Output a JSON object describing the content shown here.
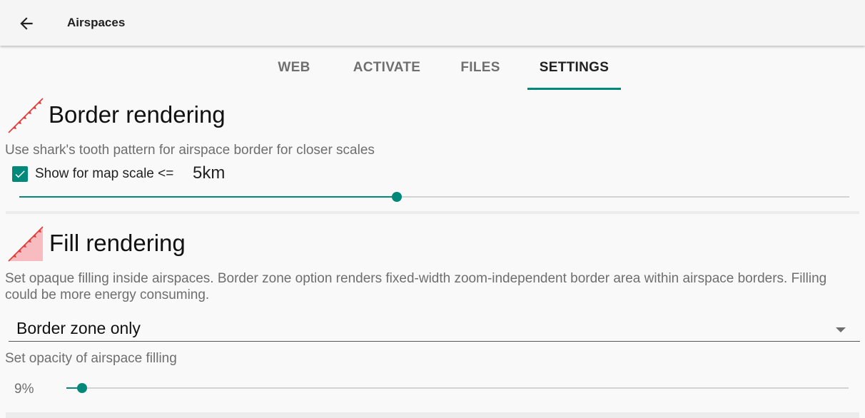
{
  "appbar": {
    "title": "Airspaces",
    "back_icon": "arrow-left-icon"
  },
  "tabs": [
    {
      "label": "WEB",
      "active": false
    },
    {
      "label": "ACTIVATE",
      "active": false
    },
    {
      "label": "FILES",
      "active": false
    },
    {
      "label": "SETTINGS",
      "active": true
    }
  ],
  "border_rendering": {
    "icon": "shark-tooth-border-icon",
    "title": "Border rendering",
    "description": "Use shark's tooth pattern for airspace border for closer scales",
    "checkbox_checked": true,
    "checkbox_label": "Show for map scale <=",
    "scale_value": "5km",
    "slider_fraction": 0.455
  },
  "fill_rendering": {
    "icon": "shark-tooth-fill-icon",
    "title": "Fill rendering",
    "description": "Set opaque filling inside airspaces. Border zone option renders fixed-width zoom-independent border area within airspace borders. Filling could be more energy consuming.",
    "mode_selected": "Border zone only",
    "opacity_label": "Set opacity of airspace filling",
    "opacity_value": "9%",
    "opacity_fraction": 0.02
  },
  "colors": {
    "accent": "#00897b",
    "border_red": "#e53935",
    "fill_pink": "#f8bbc0"
  }
}
